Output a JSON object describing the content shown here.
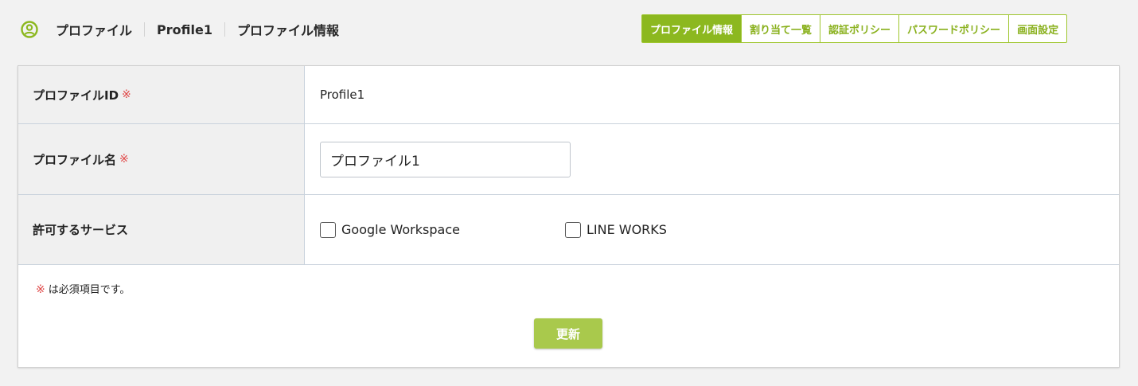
{
  "header": {
    "icon": "user-circle-icon",
    "accent_color": "#8cb81f",
    "breadcrumb": [
      "プロファイル",
      "Profile1",
      "プロファイル情報"
    ]
  },
  "tabs": [
    {
      "label": "プロファイル情報",
      "active": true
    },
    {
      "label": "割り当て一覧",
      "active": false
    },
    {
      "label": "認証ポリシー",
      "active": false
    },
    {
      "label": "パスワードポリシー",
      "active": false
    },
    {
      "label": "画面設定",
      "active": false
    }
  ],
  "form": {
    "required_mark": "※",
    "profile_id": {
      "label": "プロファイルID",
      "value": "Profile1"
    },
    "profile_name": {
      "label": "プロファイル名",
      "value": "プロファイル1"
    },
    "services": {
      "label": "許可するサービス",
      "options": [
        {
          "label": "Google Workspace",
          "checked": false
        },
        {
          "label": "LINE WORKS",
          "checked": false
        }
      ]
    },
    "note": "は必須項目です。",
    "submit_label": "更新"
  },
  "colors": {
    "required": "#e04848",
    "tab_active_bg": "#8cb81f",
    "button_bg": "#a9c94c"
  }
}
